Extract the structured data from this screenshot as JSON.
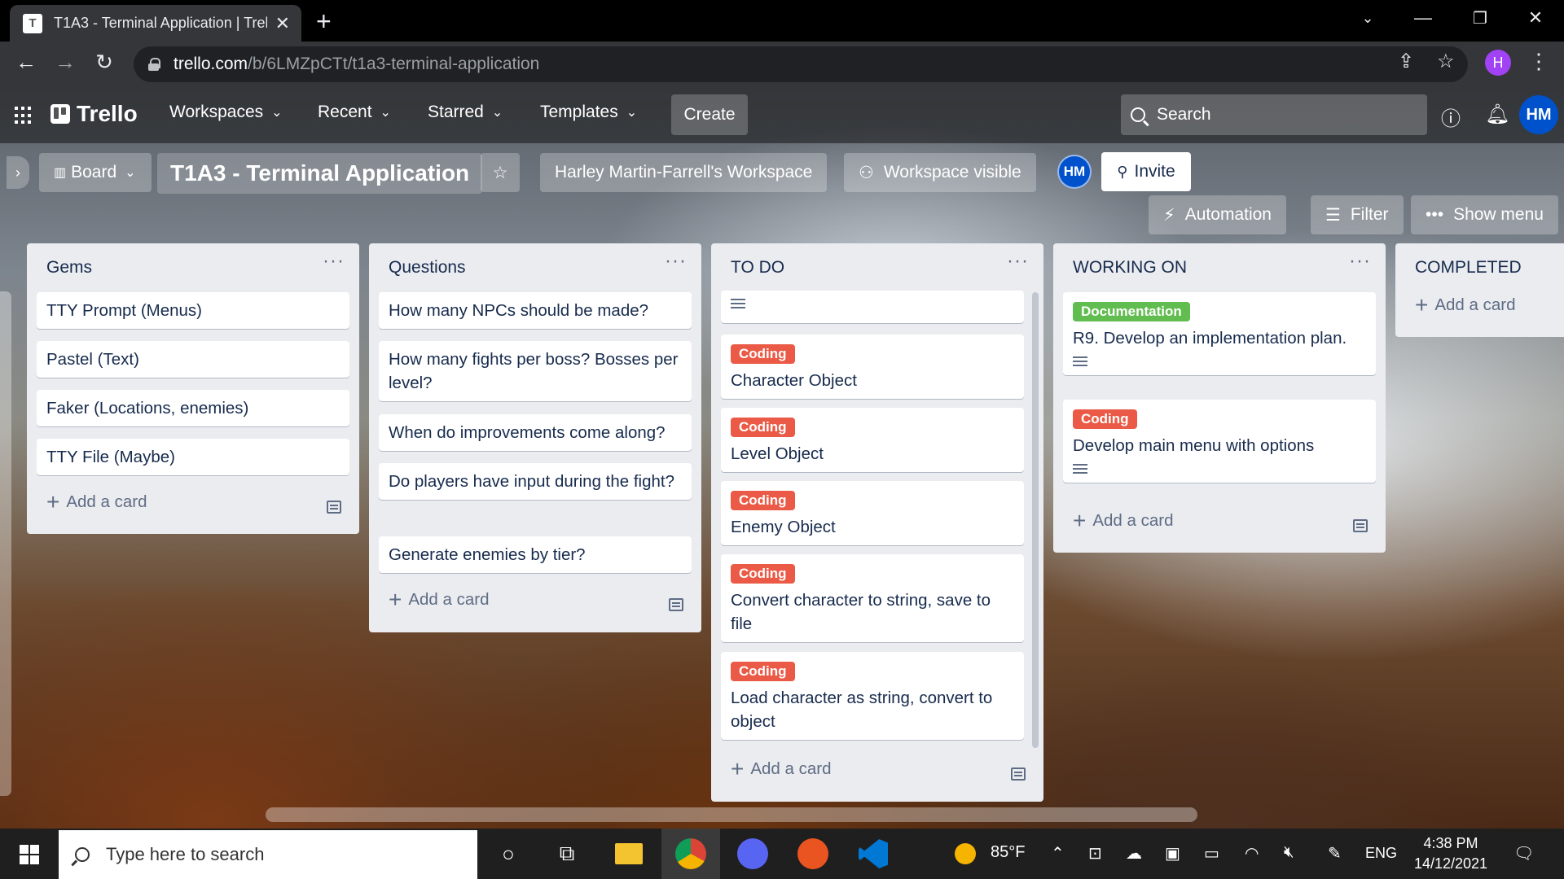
{
  "browser": {
    "tab_title": "T1A3 - Terminal Application | Trel",
    "tab_favicon_letter": "T",
    "url_host": "trello.com",
    "url_path": "/b/6LMZpCTt/t1a3-terminal-application",
    "profile_initial": "H"
  },
  "trello_header": {
    "logo": "Trello",
    "nav": [
      "Workspaces",
      "Recent",
      "Starred",
      "Templates"
    ],
    "create": "Create",
    "search_placeholder": "Search",
    "avatar": "HM"
  },
  "board": {
    "view": "Board",
    "title": "T1A3 - Terminal Application",
    "workspace": "Harley Martin-Farrell's Workspace",
    "visibility": "Workspace visible",
    "member": "HM",
    "invite": "Invite",
    "automation": "Automation",
    "filter": "Filter",
    "show_menu": "Show menu"
  },
  "lists": [
    {
      "title": "Gems",
      "cards": [
        "TTY Prompt (Menus)",
        "Pastel (Text)",
        "Faker (Locations, enemies)",
        "TTY File (Maybe)"
      ],
      "add": "Add a card"
    },
    {
      "title": "Questions",
      "cards": [
        "How many NPCs should be made?",
        "How many fights per boss? Bosses per level?",
        "When do improvements come along?",
        "Do players have input during the fight?",
        "Generate enemies by tier?"
      ],
      "add": "Add a card"
    },
    {
      "title": "TO DO",
      "label": "Coding",
      "cards": [
        "Character Object",
        "Level Object",
        "Enemy Object",
        "Convert character to string, save to file",
        "Load character as string, convert to object"
      ],
      "add": "Add a card"
    },
    {
      "title": "WORKING ON",
      "cards": [
        {
          "label": "Documentation",
          "text": "R9. Develop an implementation plan."
        },
        {
          "label": "Coding",
          "text": "Develop main menu with options"
        }
      ],
      "add": "Add a card"
    },
    {
      "title": "COMPLETED",
      "add": "Add a card"
    }
  ],
  "colors": {
    "coding_label": "#eb5a46",
    "documentation_label": "#61bd4f",
    "list_bg": "#ebecf0"
  },
  "taskbar": {
    "search_placeholder": "Type here to search",
    "weather": "85°F",
    "lang": "ENG",
    "time": "4:38 PM",
    "date": "14/12/2021"
  }
}
